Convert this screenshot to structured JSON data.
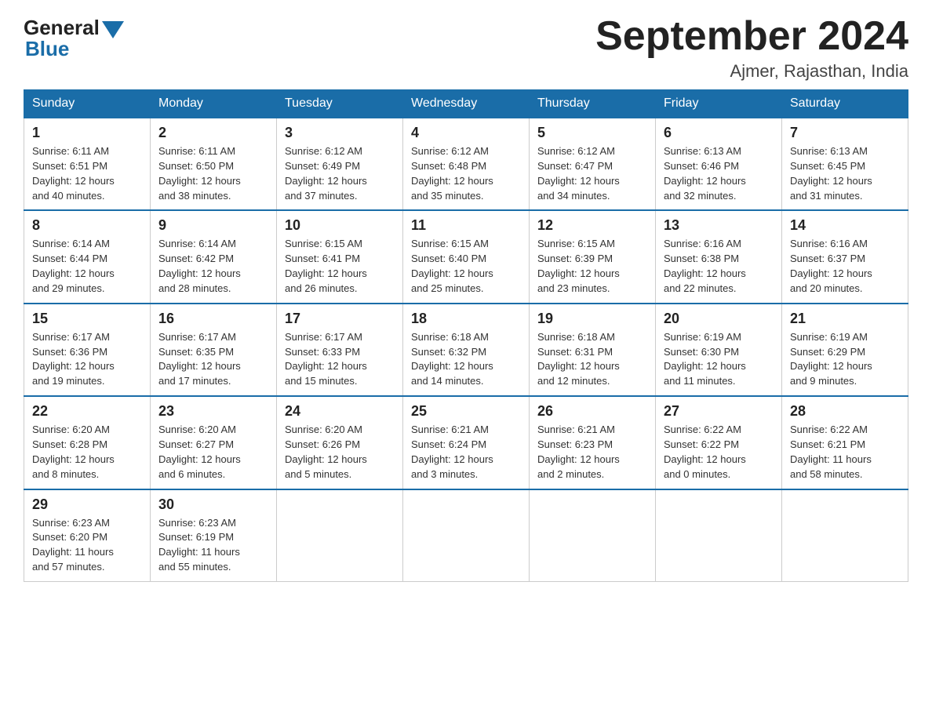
{
  "header": {
    "logo_general": "General",
    "logo_blue": "Blue",
    "month_title": "September 2024",
    "location": "Ajmer, Rajasthan, India"
  },
  "weekdays": [
    "Sunday",
    "Monday",
    "Tuesday",
    "Wednesday",
    "Thursday",
    "Friday",
    "Saturday"
  ],
  "weeks": [
    [
      {
        "day": "1",
        "sunrise": "6:11 AM",
        "sunset": "6:51 PM",
        "daylight": "12 hours and 40 minutes."
      },
      {
        "day": "2",
        "sunrise": "6:11 AM",
        "sunset": "6:50 PM",
        "daylight": "12 hours and 38 minutes."
      },
      {
        "day": "3",
        "sunrise": "6:12 AM",
        "sunset": "6:49 PM",
        "daylight": "12 hours and 37 minutes."
      },
      {
        "day": "4",
        "sunrise": "6:12 AM",
        "sunset": "6:48 PM",
        "daylight": "12 hours and 35 minutes."
      },
      {
        "day": "5",
        "sunrise": "6:12 AM",
        "sunset": "6:47 PM",
        "daylight": "12 hours and 34 minutes."
      },
      {
        "day": "6",
        "sunrise": "6:13 AM",
        "sunset": "6:46 PM",
        "daylight": "12 hours and 32 minutes."
      },
      {
        "day": "7",
        "sunrise": "6:13 AM",
        "sunset": "6:45 PM",
        "daylight": "12 hours and 31 minutes."
      }
    ],
    [
      {
        "day": "8",
        "sunrise": "6:14 AM",
        "sunset": "6:44 PM",
        "daylight": "12 hours and 29 minutes."
      },
      {
        "day": "9",
        "sunrise": "6:14 AM",
        "sunset": "6:42 PM",
        "daylight": "12 hours and 28 minutes."
      },
      {
        "day": "10",
        "sunrise": "6:15 AM",
        "sunset": "6:41 PM",
        "daylight": "12 hours and 26 minutes."
      },
      {
        "day": "11",
        "sunrise": "6:15 AM",
        "sunset": "6:40 PM",
        "daylight": "12 hours and 25 minutes."
      },
      {
        "day": "12",
        "sunrise": "6:15 AM",
        "sunset": "6:39 PM",
        "daylight": "12 hours and 23 minutes."
      },
      {
        "day": "13",
        "sunrise": "6:16 AM",
        "sunset": "6:38 PM",
        "daylight": "12 hours and 22 minutes."
      },
      {
        "day": "14",
        "sunrise": "6:16 AM",
        "sunset": "6:37 PM",
        "daylight": "12 hours and 20 minutes."
      }
    ],
    [
      {
        "day": "15",
        "sunrise": "6:17 AM",
        "sunset": "6:36 PM",
        "daylight": "12 hours and 19 minutes."
      },
      {
        "day": "16",
        "sunrise": "6:17 AM",
        "sunset": "6:35 PM",
        "daylight": "12 hours and 17 minutes."
      },
      {
        "day": "17",
        "sunrise": "6:17 AM",
        "sunset": "6:33 PM",
        "daylight": "12 hours and 15 minutes."
      },
      {
        "day": "18",
        "sunrise": "6:18 AM",
        "sunset": "6:32 PM",
        "daylight": "12 hours and 14 minutes."
      },
      {
        "day": "19",
        "sunrise": "6:18 AM",
        "sunset": "6:31 PM",
        "daylight": "12 hours and 12 minutes."
      },
      {
        "day": "20",
        "sunrise": "6:19 AM",
        "sunset": "6:30 PM",
        "daylight": "12 hours and 11 minutes."
      },
      {
        "day": "21",
        "sunrise": "6:19 AM",
        "sunset": "6:29 PM",
        "daylight": "12 hours and 9 minutes."
      }
    ],
    [
      {
        "day": "22",
        "sunrise": "6:20 AM",
        "sunset": "6:28 PM",
        "daylight": "12 hours and 8 minutes."
      },
      {
        "day": "23",
        "sunrise": "6:20 AM",
        "sunset": "6:27 PM",
        "daylight": "12 hours and 6 minutes."
      },
      {
        "day": "24",
        "sunrise": "6:20 AM",
        "sunset": "6:26 PM",
        "daylight": "12 hours and 5 minutes."
      },
      {
        "day": "25",
        "sunrise": "6:21 AM",
        "sunset": "6:24 PM",
        "daylight": "12 hours and 3 minutes."
      },
      {
        "day": "26",
        "sunrise": "6:21 AM",
        "sunset": "6:23 PM",
        "daylight": "12 hours and 2 minutes."
      },
      {
        "day": "27",
        "sunrise": "6:22 AM",
        "sunset": "6:22 PM",
        "daylight": "12 hours and 0 minutes."
      },
      {
        "day": "28",
        "sunrise": "6:22 AM",
        "sunset": "6:21 PM",
        "daylight": "11 hours and 58 minutes."
      }
    ],
    [
      {
        "day": "29",
        "sunrise": "6:23 AM",
        "sunset": "6:20 PM",
        "daylight": "11 hours and 57 minutes."
      },
      {
        "day": "30",
        "sunrise": "6:23 AM",
        "sunset": "6:19 PM",
        "daylight": "11 hours and 55 minutes."
      },
      null,
      null,
      null,
      null,
      null
    ]
  ],
  "labels": {
    "sunrise": "Sunrise:",
    "sunset": "Sunset:",
    "daylight": "Daylight:"
  }
}
